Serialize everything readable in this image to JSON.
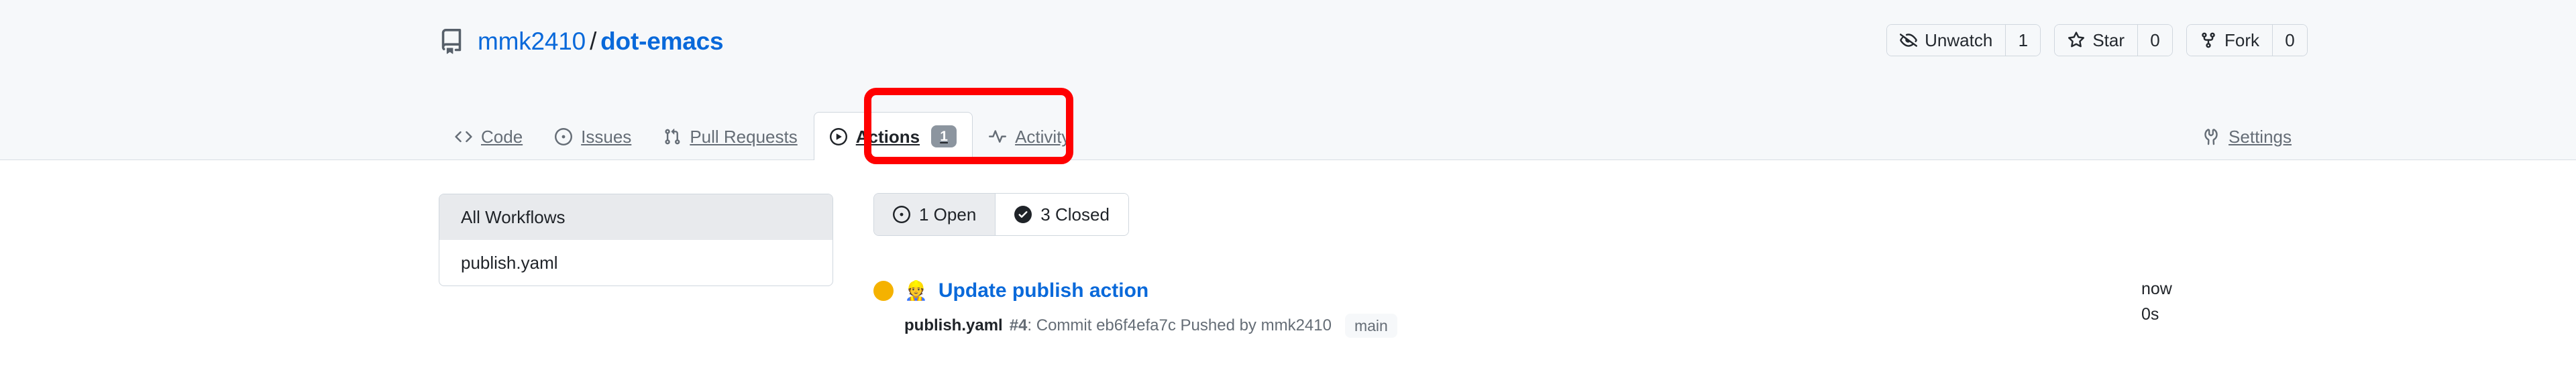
{
  "repo": {
    "icon": "repo-book-icon",
    "owner": "mmk2410",
    "separator": "/",
    "name": "dot-emacs"
  },
  "header_actions": [
    {
      "id": "unwatch",
      "icon": "eye-closed-icon",
      "label": "Unwatch",
      "count": "1"
    },
    {
      "id": "star",
      "icon": "star-icon",
      "label": "Star",
      "count": "0"
    },
    {
      "id": "fork",
      "icon": "fork-icon",
      "label": "Fork",
      "count": "0"
    }
  ],
  "nav": {
    "tabs": [
      {
        "id": "code",
        "icon": "code-icon",
        "label": "Code",
        "selected": false,
        "counter": null
      },
      {
        "id": "issues",
        "icon": "issue-opened-icon",
        "label": "Issues",
        "selected": false,
        "counter": null
      },
      {
        "id": "pull-requests",
        "icon": "git-pull-request-icon",
        "label": "Pull Requests",
        "selected": false,
        "counter": null
      },
      {
        "id": "actions",
        "icon": "play-icon",
        "label": "Actions",
        "selected": true,
        "counter": "1"
      },
      {
        "id": "activity",
        "icon": "pulse-icon",
        "label": "Activity",
        "selected": false,
        "counter": null
      }
    ],
    "right_tabs": [
      {
        "id": "settings",
        "icon": "wrench-icon",
        "label": "Settings",
        "selected": false
      }
    ]
  },
  "annotation": {
    "shape": "rounded-rectangle",
    "color": "#ff0000",
    "targets": "actions-tab"
  },
  "sidebar": {
    "items": [
      {
        "id": "all-workflows",
        "label": "All Workflows",
        "active": true
      },
      {
        "id": "publish-yaml",
        "label": "publish.yaml",
        "active": false
      }
    ]
  },
  "filters": [
    {
      "id": "open",
      "icon": "issue-opened-icon",
      "label": "1 Open",
      "selected": true
    },
    {
      "id": "closed",
      "icon": "check-circle-icon",
      "label": "3 Closed",
      "selected": false
    }
  ],
  "runs": [
    {
      "status": "in-progress",
      "status_color": "#f5b200",
      "avatar": "👷",
      "title": "Update publish action",
      "workflow_file": "publish.yaml",
      "run_number": "#4",
      "meta_rest": ": Commit eb6f4efa7c Pushed by mmk2410",
      "branch": "main",
      "time_ago": "now",
      "duration": "0s"
    }
  ],
  "colors": {
    "accent": "#0969da",
    "header_bg": "#f6f8fa",
    "border": "#d0d7de",
    "muted_text": "#656d76",
    "annotation_red": "#ff0000",
    "status_yellow": "#f5b200"
  }
}
